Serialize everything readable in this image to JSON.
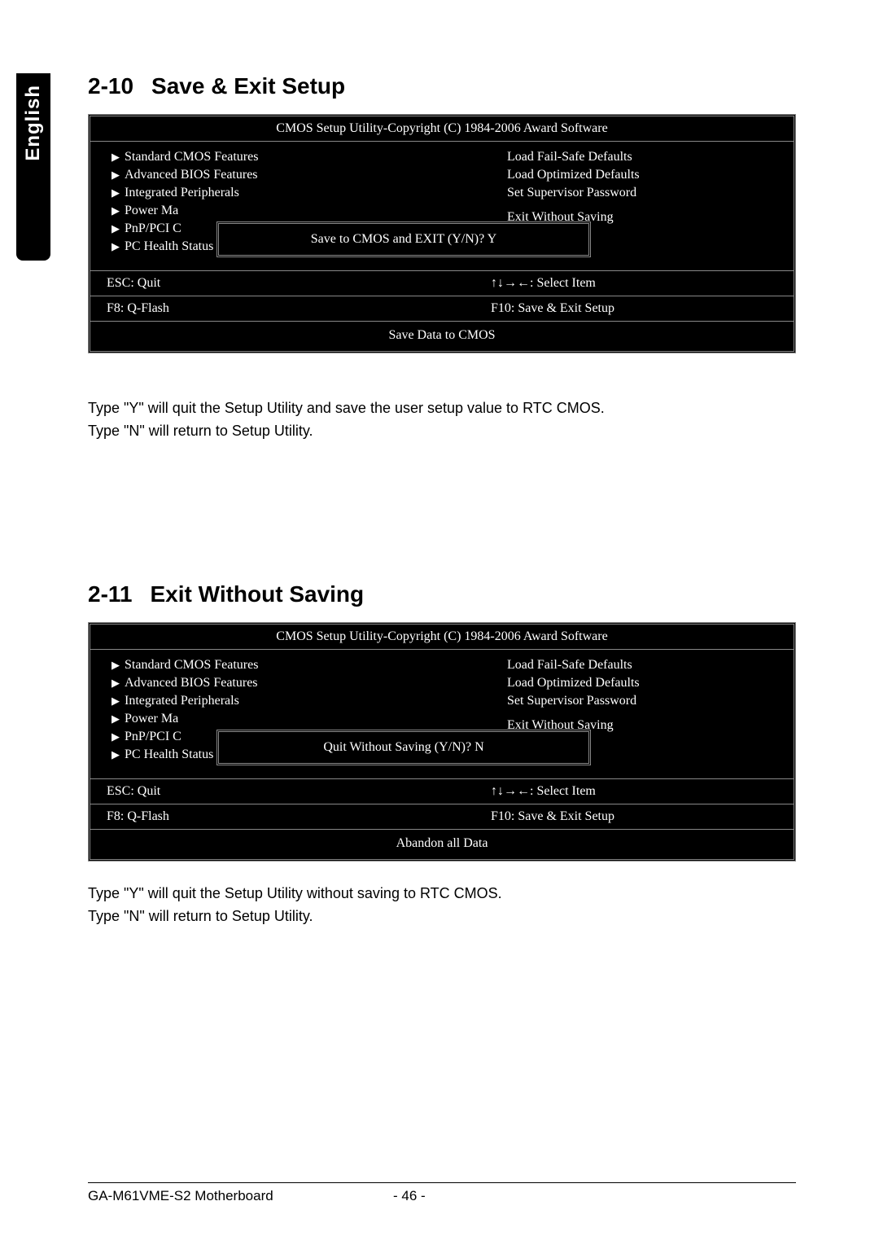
{
  "sidebar": {
    "language": "English"
  },
  "sections": {
    "s1": {
      "number": "2-10",
      "title": "Save & Exit Setup",
      "body_line1": "Type \"Y\" will quit the Setup Utility and save the user setup value to RTC CMOS.",
      "body_line2": "Type \"N\" will return to Setup Utility."
    },
    "s2": {
      "number": "2-11",
      "title": "Exit Without Saving",
      "body_line1": "Type \"Y\" will quit the Setup Utility without saving to RTC CMOS.",
      "body_line2": "Type \"N\" will return to Setup Utility."
    }
  },
  "bios": {
    "title": "CMOS Setup Utility-Copyright (C) 1984-2006 Award Software",
    "left_items": [
      "Standard CMOS Features",
      "Advanced BIOS Features",
      "Integrated Peripherals",
      "Power Ma",
      "PnP/PCI C",
      "PC Health Status"
    ],
    "right_items": [
      "Load Fail-Safe Defaults",
      "Load Optimized Defaults",
      "Set Supervisor Password",
      "",
      "",
      "Exit Without Saving"
    ],
    "foot": {
      "esc": "ESC: Quit",
      "arrows": "↑↓→←: Select Item",
      "f8": "F8: Q-Flash",
      "f10": "F10: Save & Exit Setup"
    },
    "status1": "Save Data to CMOS",
    "status2": "Abandon all Data",
    "dialog1": "Save to CMOS and EXIT (Y/N)? Y",
    "dialog2": "Quit Without Saving (Y/N)? N"
  },
  "footer": {
    "product": "GA-M61VME-S2 Motherboard",
    "page": "- 46 -"
  }
}
